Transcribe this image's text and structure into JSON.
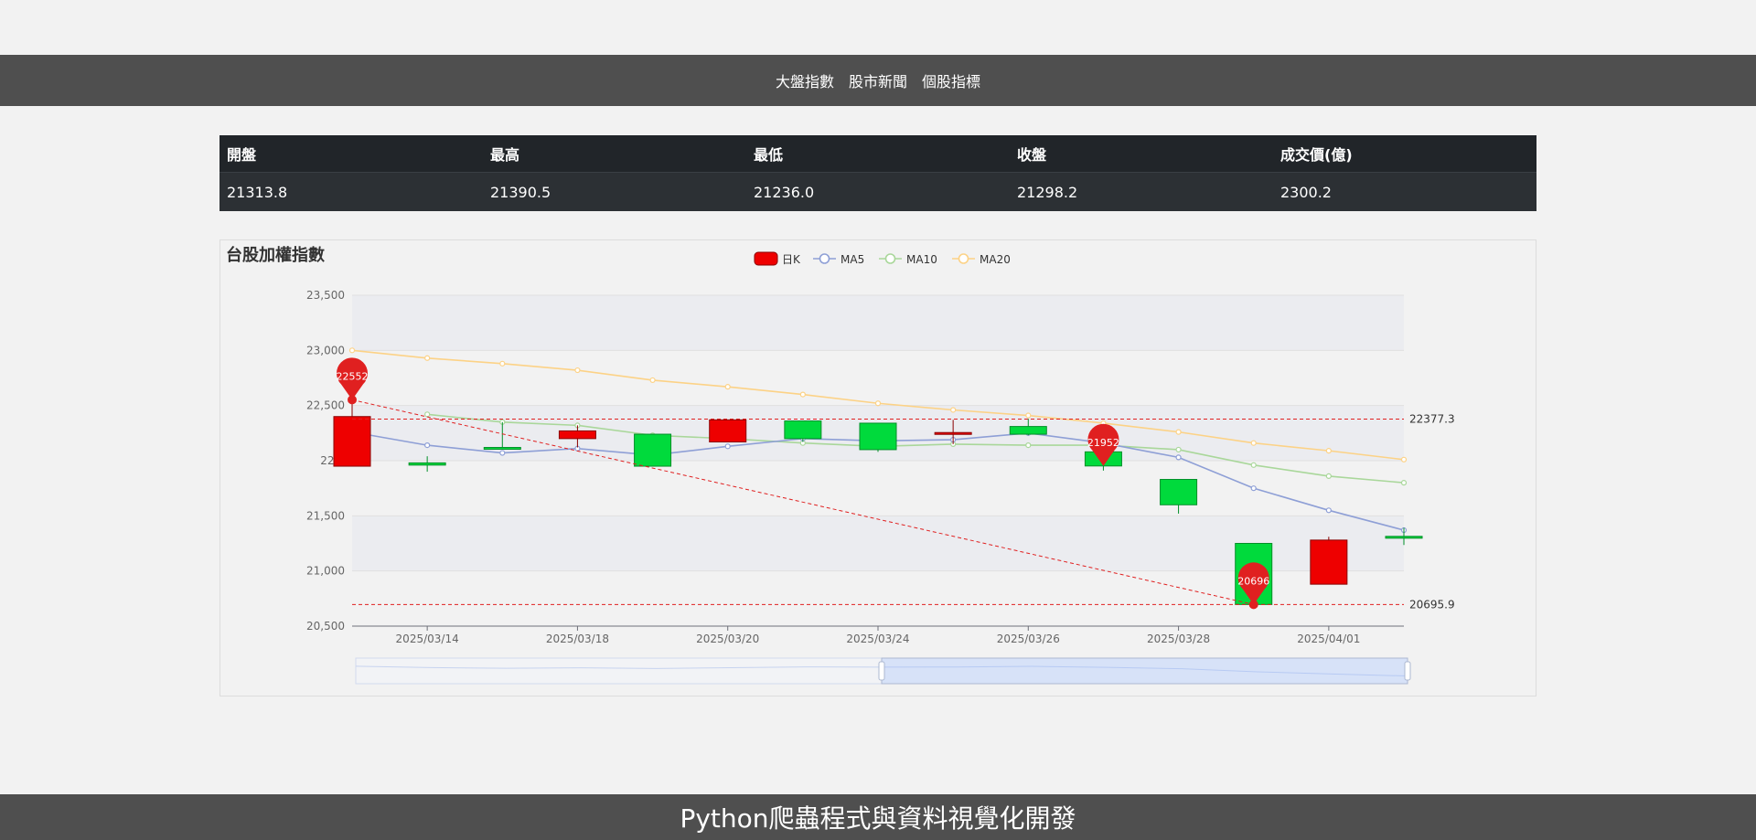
{
  "nav": [
    {
      "label": "大盤指數"
    },
    {
      "label": "股市新聞"
    },
    {
      "label": "個股指標"
    }
  ],
  "stats": {
    "headers": [
      "開盤",
      "最高",
      "最低",
      "收盤",
      "成交價(億)"
    ],
    "values": [
      "21313.8",
      "21390.5",
      "21236.0",
      "21298.2",
      "2300.2"
    ]
  },
  "chart_title": "台股加權指數",
  "footer": "Python爬蟲程式與資料視覺化開發",
  "colors": {
    "up": "#ee0000",
    "down": "#00da3c",
    "ma5": "#8e9fd6",
    "ma10": "#a9d79a",
    "ma20": "#fcd286",
    "markline": "#e02020"
  },
  "chart_data": {
    "type": "candlestick",
    "legend": [
      "日K",
      "MA5",
      "MA10",
      "MA20"
    ],
    "legend_position": "top-center",
    "ylim": [
      20500,
      23500
    ],
    "yticks": [
      20500,
      21000,
      21500,
      22000,
      22500,
      23000,
      23500
    ],
    "ytick_labels": [
      "20,500",
      "21,000",
      "21,500",
      "22,0",
      "22,500",
      "23,000",
      "23,500"
    ],
    "xtick_labels": [
      "2025/03/14",
      "2025/03/18",
      "2025/03/20",
      "2025/03/24",
      "2025/03/26",
      "2025/03/28",
      "2025/04/01"
    ],
    "xtick_indices": [
      1,
      3,
      5,
      7,
      9,
      11,
      13
    ],
    "candles": [
      {
        "open": 21950,
        "close": 22400,
        "low": 21950,
        "high": 22552
      },
      {
        "open": 21980,
        "close": 21960,
        "low": 21900,
        "high": 22040
      },
      {
        "open": 22120,
        "close": 22110,
        "low": 22100,
        "high": 22350
      },
      {
        "open": 22200,
        "close": 22270,
        "low": 22120,
        "high": 22320
      },
      {
        "open": 22240,
        "close": 21950,
        "low": 21950,
        "high": 22240
      },
      {
        "open": 22170,
        "close": 22370,
        "low": 22170,
        "high": 22370
      },
      {
        "open": 22360,
        "close": 22200,
        "low": 22170,
        "high": 22360
      },
      {
        "open": 22340,
        "close": 22100,
        "low": 22080,
        "high": 22340
      },
      {
        "open": 22250,
        "close": 22255,
        "low": 22150,
        "high": 22370
      },
      {
        "open": 22310,
        "close": 22240,
        "low": 22230,
        "high": 22380
      },
      {
        "open": 22080,
        "close": 21952,
        "low": 21910,
        "high": 22120
      },
      {
        "open": 21830,
        "close": 21600,
        "low": 21520,
        "high": 21830
      },
      {
        "open": 21250,
        "close": 20696,
        "low": 20696,
        "high": 21250
      },
      {
        "open": 20880,
        "close": 21280,
        "low": 20880,
        "high": 21310
      },
      {
        "open": 21313.8,
        "close": 21298.2,
        "low": 21236.0,
        "high": 21390.5
      }
    ],
    "ma5": [
      22260,
      22140,
      22070,
      22110,
      22050,
      22130,
      22200,
      22180,
      22190,
      22250,
      22160,
      22030,
      21750,
      21550,
      21370
    ],
    "ma10": [
      null,
      22420,
      22350,
      22320,
      22230,
      22200,
      22160,
      22130,
      22150,
      22140,
      22140,
      22100,
      21960,
      21860,
      21800
    ],
    "ma20": [
      23000,
      22930,
      22880,
      22820,
      22730,
      22670,
      22600,
      22520,
      22460,
      22410,
      22340,
      22260,
      22160,
      22090,
      22010
    ],
    "markpoints": [
      {
        "label": "22552",
        "index": 0,
        "value": 22552
      },
      {
        "label": "21952",
        "index": 10,
        "value": 21952
      },
      {
        "label": "20696",
        "index": 12,
        "value": 20696
      }
    ],
    "marklines": [
      {
        "label": "22377.3",
        "value": 22377.3
      },
      {
        "label": "20695.9",
        "value": 20695.9
      }
    ],
    "trendline": {
      "from_index": 0,
      "from_value": 22552,
      "to_index": 12,
      "to_value": 20696
    },
    "datazoom": {
      "start_percent": 50,
      "end_percent": 100
    }
  }
}
